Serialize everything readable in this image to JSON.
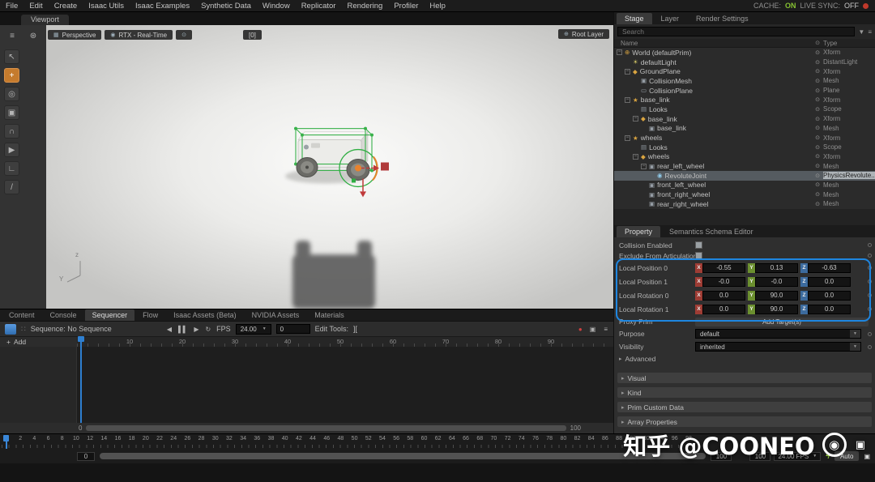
{
  "menubar": {
    "items": [
      "File",
      "Edit",
      "Create",
      "Isaac Utils",
      "Isaac Examples",
      "Synthetic Data",
      "Window",
      "Replicator",
      "Rendering",
      "Profiler",
      "Help"
    ],
    "cache_label": "CACHE:",
    "cache_value": "ON",
    "livesync_label": "LIVE SYNC:",
    "livesync_value": "OFF"
  },
  "viewport": {
    "tab": "Viewport",
    "perspective": "Perspective",
    "renderer": "RTX - Real-Time",
    "badge": "[0]",
    "root_layer": "Root Layer",
    "axis_v": "z",
    "axis_h": "Y",
    "tools": [
      {
        "name": "tool-select",
        "glyph": "↖"
      },
      {
        "name": "tool-move",
        "glyph": "+",
        "active": true
      },
      {
        "name": "tool-zoom",
        "glyph": "◎"
      },
      {
        "name": "tool-frame",
        "glyph": "▣"
      },
      {
        "name": "tool-audio",
        "glyph": "∩"
      },
      {
        "name": "tool-play",
        "glyph": "▶"
      },
      {
        "name": "tool-pose",
        "glyph": "∟"
      },
      {
        "name": "tool-paint",
        "glyph": "/"
      }
    ]
  },
  "stage": {
    "tabs": [
      {
        "label": "Stage",
        "active": true
      },
      {
        "label": "Layer",
        "active": false
      },
      {
        "label": "Render Settings",
        "active": false
      }
    ],
    "search_placeholder": "Search",
    "columns": {
      "name": "Name",
      "type": "Type"
    },
    "tree": [
      {
        "indent": 0,
        "expand": "-",
        "label": "World (defaultPrim)",
        "type": "Xform",
        "icon": "world",
        "selected": false
      },
      {
        "indent": 1,
        "expand": "",
        "label": "defaultLight",
        "type": "DistantLight",
        "icon": "light",
        "selected": false
      },
      {
        "indent": 1,
        "expand": "-",
        "label": "GroundPlane",
        "type": "Xform",
        "icon": "xform",
        "selected": false
      },
      {
        "indent": 2,
        "expand": "",
        "label": "CollisionMesh",
        "type": "Mesh",
        "icon": "mesh",
        "selected": false
      },
      {
        "indent": 2,
        "expand": "",
        "label": "CollisionPlane",
        "type": "Plane",
        "icon": "plane",
        "selected": false
      },
      {
        "indent": 1,
        "expand": "-",
        "label": "base_link",
        "type": "Xform",
        "icon": "articulation",
        "selected": false
      },
      {
        "indent": 2,
        "expand": "",
        "label": "Looks",
        "type": "Scope",
        "icon": "folder",
        "selected": false
      },
      {
        "indent": 2,
        "expand": "-",
        "label": "base_link",
        "type": "Xform",
        "icon": "xform",
        "selected": false
      },
      {
        "indent": 3,
        "expand": "",
        "label": "base_link",
        "type": "Mesh",
        "icon": "mesh",
        "selected": false
      },
      {
        "indent": 1,
        "expand": "-",
        "label": "wheels",
        "type": "Xform",
        "icon": "articulation",
        "selected": false
      },
      {
        "indent": 2,
        "expand": "",
        "label": "Looks",
        "type": "Scope",
        "icon": "folder",
        "selected": false
      },
      {
        "indent": 2,
        "expand": "-",
        "label": "wheels",
        "type": "Xform",
        "icon": "xform",
        "selected": false
      },
      {
        "indent": 3,
        "expand": "-",
        "label": "rear_left_wheel",
        "type": "Mesh",
        "icon": "mesh",
        "selected": false
      },
      {
        "indent": 4,
        "expand": "",
        "label": "RevoluteJoint",
        "type": "PhysicsRevolute...",
        "icon": "joint",
        "selected": true
      },
      {
        "indent": 3,
        "expand": "",
        "label": "front_left_wheel",
        "type": "Mesh",
        "icon": "mesh",
        "selected": false
      },
      {
        "indent": 3,
        "expand": "",
        "label": "front_right_wheel",
        "type": "Mesh",
        "icon": "mesh",
        "selected": false
      },
      {
        "indent": 3,
        "expand": "",
        "label": "rear_right_wheel",
        "type": "Mesh",
        "icon": "mesh",
        "selected": false
      }
    ]
  },
  "properties": {
    "tabs": [
      {
        "label": "Property",
        "active": true
      },
      {
        "label": "Semantics Schema Editor",
        "active": false
      }
    ],
    "checkboxes": [
      {
        "label": "Collision Enabled"
      },
      {
        "label": "Exclude From Articulation"
      }
    ],
    "vectors": [
      {
        "label": "Local Position 0",
        "x": "-0.55",
        "y": "0.13",
        "z": "-0.63"
      },
      {
        "label": "Local Position 1",
        "x": "-0.0",
        "y": "-0.0",
        "z": "0.0"
      },
      {
        "label": "Local Rotation 0",
        "x": "0.0",
        "y": "90.0",
        "z": "0.0"
      },
      {
        "label": "Local Rotation 1",
        "x": "0.0",
        "y": "90.0",
        "z": "0.0"
      }
    ],
    "proxy_prim_label": "Proxy Prim",
    "add_targets_label": "Add Target(s)",
    "dropdown_rows": [
      {
        "label": "Purpose",
        "value": "default"
      },
      {
        "label": "Visibility",
        "value": "inherited"
      }
    ],
    "advanced_label": "Advanced",
    "sections": [
      "Visual",
      "Kind",
      "Prim Custom Data",
      "Array Properties"
    ]
  },
  "bottom_tabs": [
    {
      "label": "Content",
      "active": false
    },
    {
      "label": "Console",
      "active": false
    },
    {
      "label": "Sequencer",
      "active": true
    },
    {
      "label": "Flow",
      "active": false
    },
    {
      "label": "Isaac Assets (Beta)",
      "active": false
    },
    {
      "label": "NVIDIA Assets",
      "active": false
    },
    {
      "label": "Materials",
      "active": false
    }
  ],
  "sequencer": {
    "sequence_label": "Sequence: No Sequence",
    "fps_label": "FPS",
    "fps_value": "24.00",
    "frame_value": "0",
    "edit_tools_label": "Edit Tools:",
    "edit_tools_icon": "][",
    "add_label": "Add",
    "ruler": [
      "10",
      "20",
      "30",
      "40",
      "50",
      "60",
      "70",
      "80",
      "90"
    ],
    "scroll_start": "0",
    "scroll_end": "100"
  },
  "timeline": {
    "ticks": [
      "0",
      "2",
      "4",
      "6",
      "8",
      "10",
      "12",
      "14",
      "16",
      "18",
      "20",
      "22",
      "24",
      "26",
      "28",
      "30",
      "32",
      "34",
      "36",
      "38",
      "40",
      "42",
      "44",
      "46",
      "48",
      "50",
      "52",
      "54",
      "56",
      "58",
      "60",
      "62",
      "64",
      "66",
      "68",
      "70",
      "72",
      "74",
      "76",
      "78",
      "80",
      "82",
      "84",
      "86",
      "88",
      "90",
      "92",
      "94",
      "96",
      "98"
    ],
    "start_value": "0",
    "end_value": "100",
    "end_value2": "100",
    "fps": "24.00 FPS",
    "auto_label": "Auto"
  },
  "watermark": {
    "text": "知乎 @COONEO"
  },
  "colors": {
    "accent_blue": "#1e86e0",
    "gizmo_green": "#2fae42",
    "gizmo_red": "#c03a3a",
    "gizmo_orange": "#e8822c",
    "tool_active_orange": "#c57b2d",
    "cache_on_green": "#86c232"
  }
}
